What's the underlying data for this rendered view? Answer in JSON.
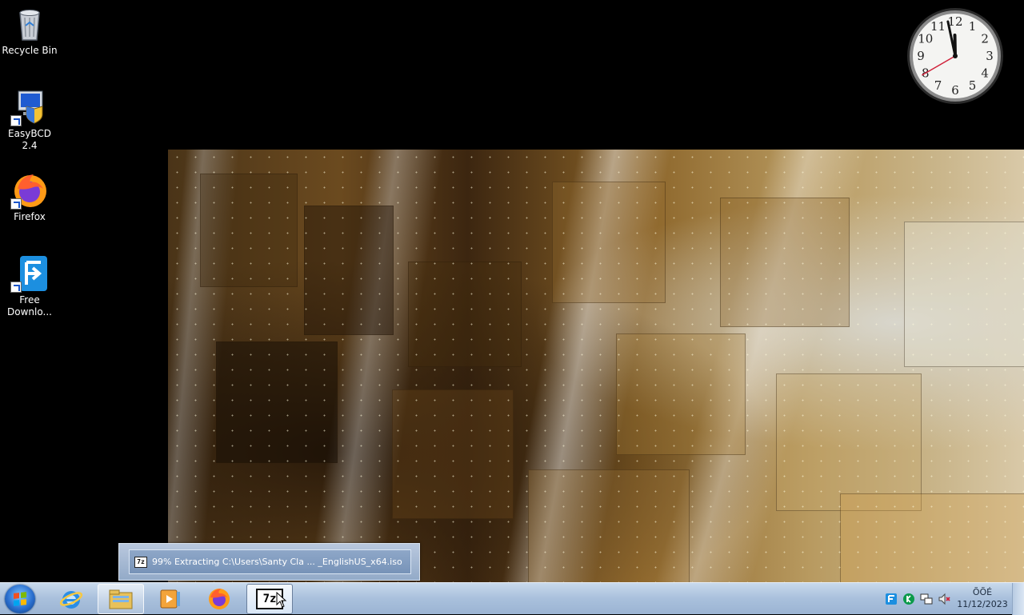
{
  "desktop": {
    "icons": [
      {
        "label": "Recycle Bin",
        "icon": "recycle-bin-icon"
      },
      {
        "label": "EasyBCD 2.4",
        "icon": "easybcd-icon"
      },
      {
        "label": "Firefox",
        "icon": "firefox-icon"
      },
      {
        "label": "Free Downlo...",
        "icon": "free-download-manager-icon"
      }
    ]
  },
  "clock": {
    "hour": 11,
    "minute": 58,
    "second": 40
  },
  "progress_tooltip": {
    "text": "99% Extracting C:\\Users\\Santy Cla ... _EnglishUS_x64.iso",
    "icon_text": "7z"
  },
  "taskbar": {
    "buttons": [
      {
        "name": "internet-explorer",
        "icon": "internet-explorer-icon"
      },
      {
        "name": "windows-explorer",
        "icon": "folder-icon"
      },
      {
        "name": "media-player",
        "icon": "media-player-icon"
      },
      {
        "name": "firefox",
        "icon": "firefox-icon"
      },
      {
        "name": "7-zip",
        "icon": "seven-zip-icon",
        "icon_text": "7z"
      }
    ],
    "tray": {
      "icons": [
        "free-download-manager-tray-icon",
        "kaspersky-icon",
        "network-icon",
        "volume-muted-icon"
      ],
      "time": "ÕÕÉ",
      "date": "11/12/2023"
    }
  },
  "colors": {
    "taskbar": "#a9c0dc",
    "accent": "#2a6fcf"
  }
}
